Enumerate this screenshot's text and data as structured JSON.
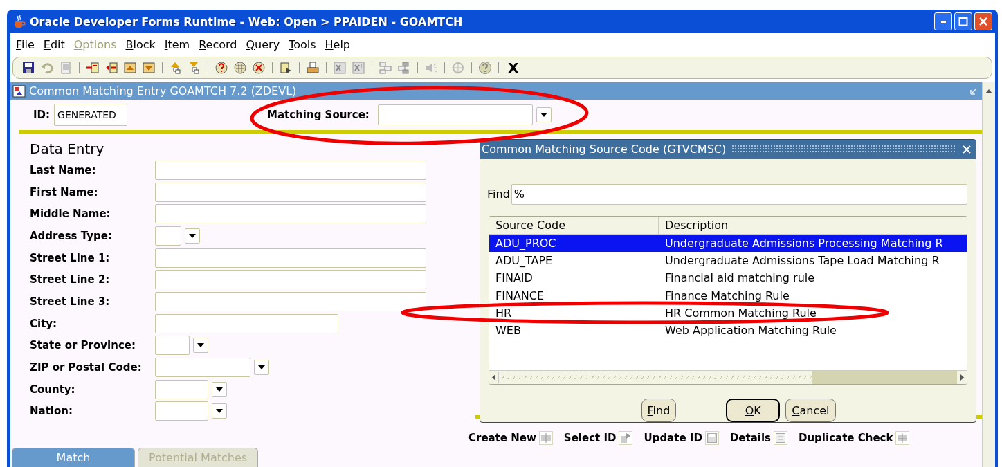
{
  "window": {
    "title": "Oracle Developer Forms Runtime - Web:  Open > PPAIDEN - GOAMTCH"
  },
  "menu": [
    {
      "label": "File",
      "disabled": false
    },
    {
      "label": "Edit",
      "disabled": false
    },
    {
      "label": "Options",
      "disabled": true
    },
    {
      "label": "Block",
      "disabled": false
    },
    {
      "label": "Item",
      "disabled": false
    },
    {
      "label": "Record",
      "disabled": false
    },
    {
      "label": "Query",
      "disabled": false
    },
    {
      "label": "Tools",
      "disabled": false
    },
    {
      "label": "Help",
      "disabled": false
    }
  ],
  "toolbar": {
    "exit_label": "X"
  },
  "form": {
    "title": "Common Matching Entry  GOAMTCH  7.2  (ZDEVL)",
    "id_label": "ID:",
    "id_value": "GENERATED",
    "source_label": "Matching Source:"
  },
  "data_entry": {
    "heading": "Data Entry",
    "fields": [
      {
        "label": "Last Name:",
        "kind": "text"
      },
      {
        "label": "First Name:",
        "kind": "text"
      },
      {
        "label": "Middle Name:",
        "kind": "text"
      },
      {
        "label": "Address Type:",
        "kind": "lookup"
      },
      {
        "label": "Street Line 1:",
        "kind": "text"
      },
      {
        "label": "Street Line 2:",
        "kind": "text"
      },
      {
        "label": "Street Line 3:",
        "kind": "text"
      },
      {
        "label": "City:",
        "kind": "text"
      },
      {
        "label": "State or Province:",
        "kind": "lookup"
      },
      {
        "label": "ZIP or Postal Code:",
        "kind": "lookup"
      },
      {
        "label": "County:",
        "kind": "lookup"
      },
      {
        "label": "Nation:",
        "kind": "lookup"
      }
    ]
  },
  "actions": [
    {
      "label": "Create New"
    },
    {
      "label": "Select ID"
    },
    {
      "label": "Update ID"
    },
    {
      "label": "Details"
    },
    {
      "label": "Duplicate Check"
    }
  ],
  "tabs": [
    {
      "label": "Match",
      "selected": true
    },
    {
      "label": "Potential Matches",
      "selected": false
    }
  ],
  "dialog": {
    "title": "Common Matching Source Code (GTVCMSC)",
    "find_label": "Find",
    "find_value": "%",
    "columns": [
      "Source Code",
      "Description"
    ],
    "rows": [
      {
        "code": "ADU_PROC",
        "description": "Undergraduate Admissions Processing Matching R",
        "selected": true
      },
      {
        "code": "ADU_TAPE",
        "description": "Undergraduate Admissions Tape Load Matching R",
        "selected": false
      },
      {
        "code": "FINAID",
        "description": "Financial aid matching rule",
        "selected": false
      },
      {
        "code": "FINANCE",
        "description": "Finance Matching Rule",
        "selected": false
      },
      {
        "code": "HR",
        "description": "HR Common Matching Rule",
        "selected": false
      },
      {
        "code": "WEB",
        "description": "Web Application Matching Rule",
        "selected": false
      }
    ],
    "buttons": [
      {
        "label": "Find",
        "default": false
      },
      {
        "label": "OK",
        "default": true
      },
      {
        "label": "Cancel",
        "default": false
      }
    ]
  },
  "annotations": [
    {
      "kind": "ellipse"
    },
    {
      "kind": "ellipse"
    }
  ]
}
